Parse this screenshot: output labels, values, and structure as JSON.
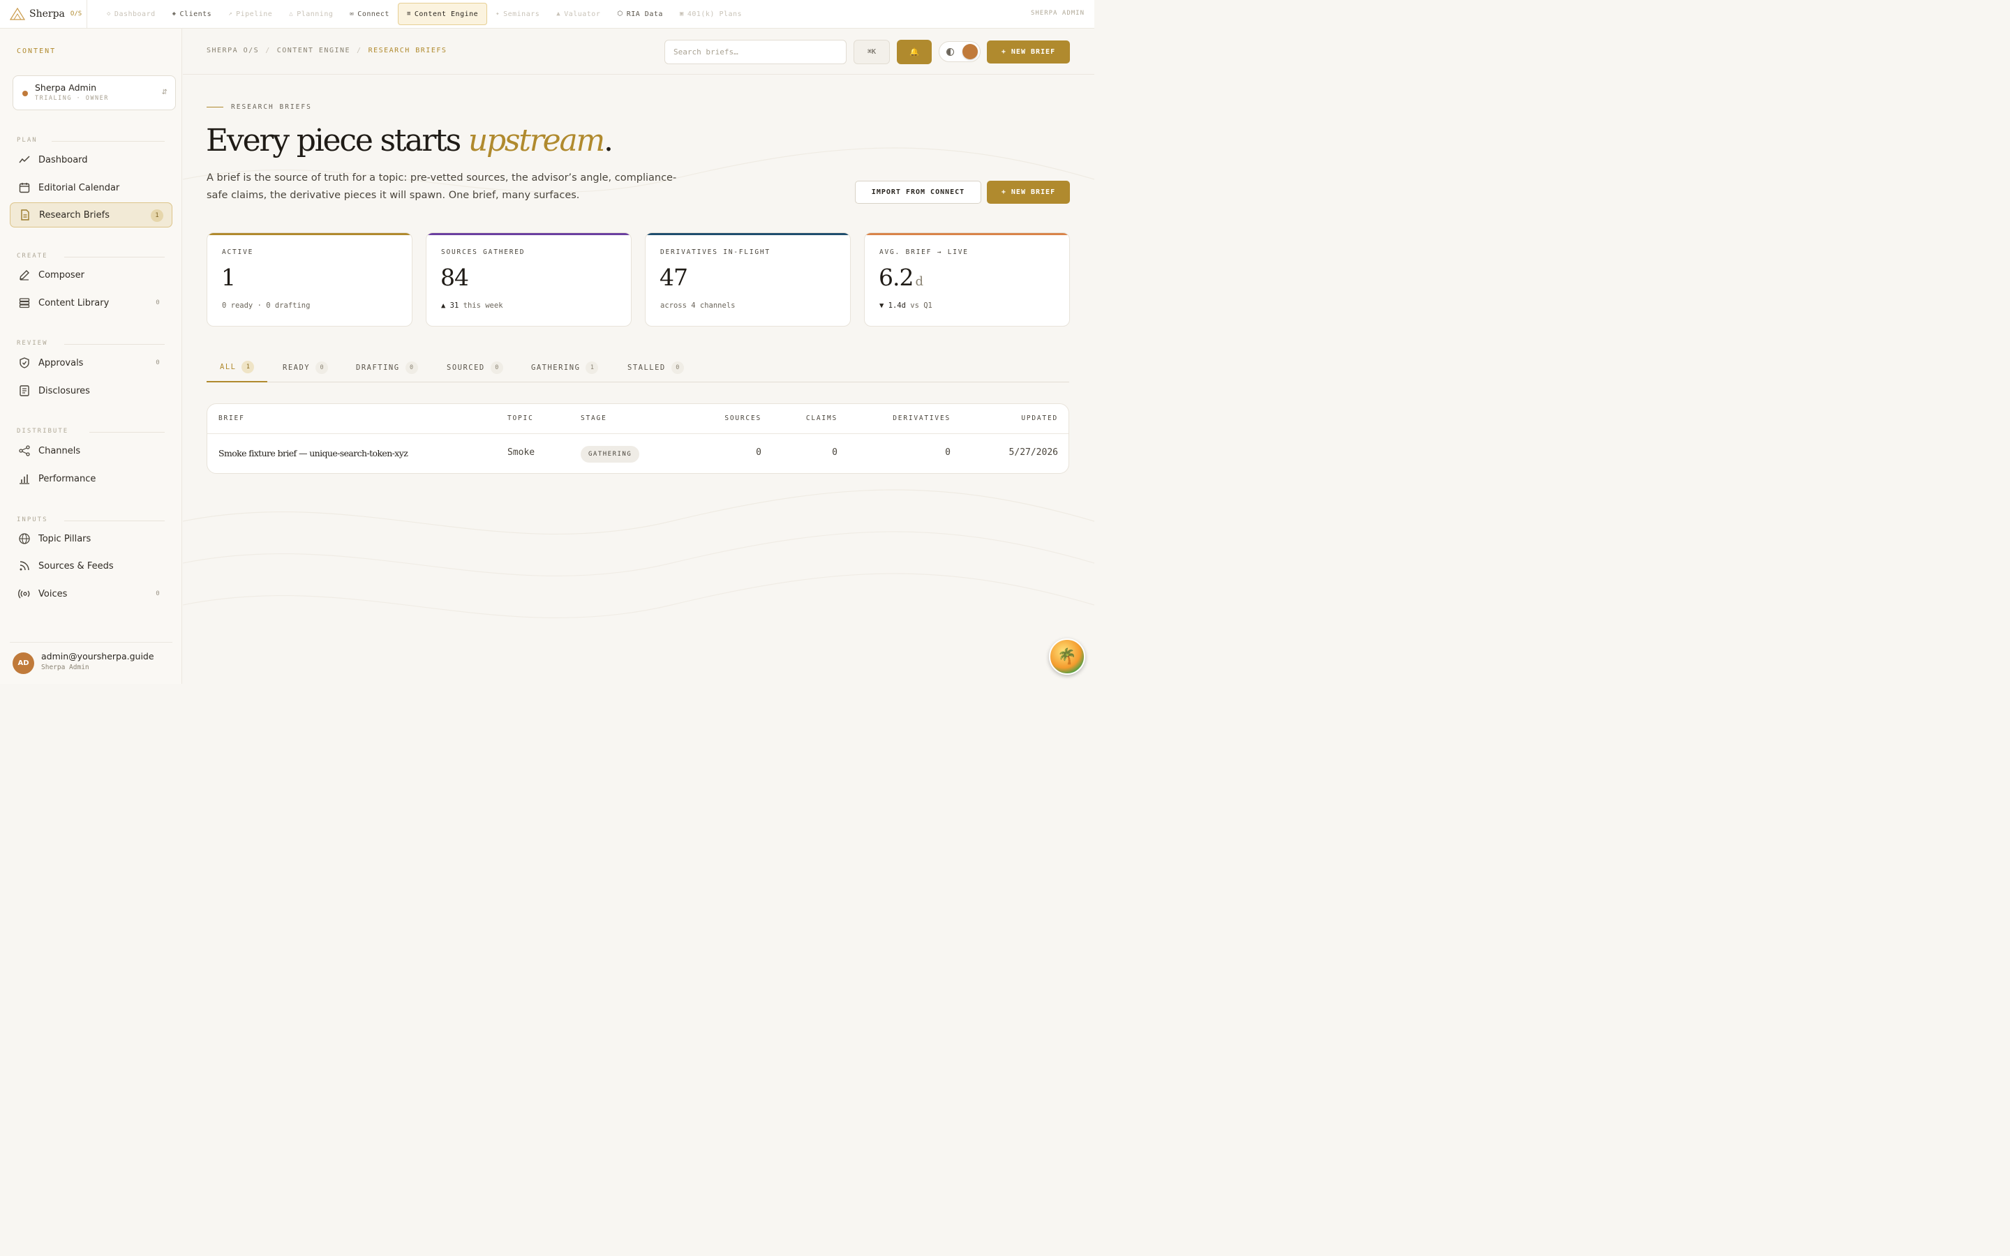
{
  "brand": {
    "name": "Sherpa",
    "suffix": "O/S"
  },
  "topnav": {
    "tabs": [
      {
        "label": "Dashboard",
        "icon": "◇",
        "state": "disabled"
      },
      {
        "label": "Clients",
        "icon": "◈",
        "state": "enabled"
      },
      {
        "label": "Pipeline",
        "icon": "↗",
        "state": "disabled"
      },
      {
        "label": "Planning",
        "icon": "△",
        "state": "disabled"
      },
      {
        "label": "Connect",
        "icon": "✉",
        "state": "enabled"
      },
      {
        "label": "Content Engine",
        "icon": "≡",
        "state": "active"
      },
      {
        "label": "Seminars",
        "icon": "✦",
        "state": "disabled"
      },
      {
        "label": "Valuator",
        "icon": "▲",
        "state": "disabled"
      },
      {
        "label": "RIA Data",
        "icon": "⬡",
        "state": "enabled"
      },
      {
        "label": "401(k) Plans",
        "icon": "▣",
        "state": "disabled"
      }
    ],
    "right_label": "SHERPA ADMIN"
  },
  "sidebar": {
    "heading": "CONTENT",
    "workspace": {
      "name": "Sherpa Admin",
      "sub": "TRIALING · OWNER",
      "toggle": "⇵"
    },
    "sections": [
      {
        "label": "PLAN",
        "items": [
          {
            "label": "Dashboard",
            "icon": "trend-icon"
          },
          {
            "label": "Editorial Calendar",
            "icon": "calendar-icon"
          },
          {
            "label": "Research Briefs",
            "icon": "document-icon",
            "count": "1",
            "active": true
          }
        ]
      },
      {
        "label": "CREATE",
        "items": [
          {
            "label": "Composer",
            "icon": "pen-icon"
          },
          {
            "label": "Content Library",
            "icon": "stack-icon",
            "count": "0"
          }
        ]
      },
      {
        "label": "REVIEW",
        "items": [
          {
            "label": "Approvals",
            "icon": "shield-icon",
            "count": "0"
          },
          {
            "label": "Disclosures",
            "icon": "list-doc-icon"
          }
        ]
      },
      {
        "label": "DISTRIBUTE",
        "items": [
          {
            "label": "Channels",
            "icon": "share-icon"
          },
          {
            "label": "Performance",
            "icon": "bar-chart-icon"
          }
        ]
      },
      {
        "label": "INPUTS",
        "items": [
          {
            "label": "Topic Pillars",
            "icon": "globe-icon"
          },
          {
            "label": "Sources & Feeds",
            "icon": "rss-icon"
          },
          {
            "label": "Voices",
            "icon": "broadcast-icon",
            "count": "0"
          }
        ]
      }
    ],
    "user": {
      "initials": "AD",
      "email": "admin@yoursherpa.guide",
      "role": "Sherpa Admin"
    }
  },
  "header": {
    "breadcrumb": [
      "SHERPA O/S",
      "CONTENT ENGINE",
      "RESEARCH BRIEFS"
    ],
    "search_placeholder": "Search briefs…",
    "kbd": "⌘K",
    "bell": "🔔",
    "new_brief": "+ NEW BRIEF"
  },
  "hero": {
    "eyebrow": "RESEARCH BRIEFS",
    "title_main": "Every piece starts ",
    "title_emphasis": "upstream",
    "title_end": ".",
    "description": "A brief is the source of truth for a topic: pre-vetted sources, the advisor’s angle, compliance-safe claims, the derivative pieces it will spawn. One brief, many surfaces.",
    "import_label": "IMPORT FROM CONNECT",
    "new_label": "+ NEW BRIEF"
  },
  "stats": [
    {
      "label": "ACTIVE",
      "value": "1",
      "unit": "",
      "sub_strong": "",
      "sub": "0 ready · 0 drafting",
      "color": "#b08a2e"
    },
    {
      "label": "SOURCES GATHERED",
      "value": "84",
      "unit": "",
      "sub_strong": "▲ 31",
      "sub": " this week",
      "color": "#6b3fa0"
    },
    {
      "label": "DERIVATIVES IN-FLIGHT",
      "value": "47",
      "unit": "",
      "sub_strong": "",
      "sub": "across 4 channels",
      "color": "#1f4e6e"
    },
    {
      "label": "AVG. BRIEF → LIVE",
      "value": "6.2",
      "unit": "d",
      "sub_strong": "▼ 1.4d",
      "sub": " vs Q1",
      "color": "#d9844a"
    }
  ],
  "filters": [
    {
      "label": "ALL",
      "count": "1",
      "active": true
    },
    {
      "label": "READY",
      "count": "0"
    },
    {
      "label": "DRAFTING",
      "count": "0"
    },
    {
      "label": "SOURCED",
      "count": "0"
    },
    {
      "label": "GATHERING",
      "count": "1"
    },
    {
      "label": "STALLED",
      "count": "0"
    }
  ],
  "table": {
    "columns": [
      "BRIEF",
      "TOPIC",
      "STAGE",
      "SOURCES",
      "CLAIMS",
      "DERIVATIVES",
      "UPDATED"
    ],
    "rows": [
      {
        "brief": "Smoke fixture brief — unique-search-token-xyz",
        "topic": "Smoke",
        "stage": "GATHERING",
        "sources": "0",
        "claims": "0",
        "derivatives": "0",
        "updated": "5/27/2026"
      }
    ]
  }
}
